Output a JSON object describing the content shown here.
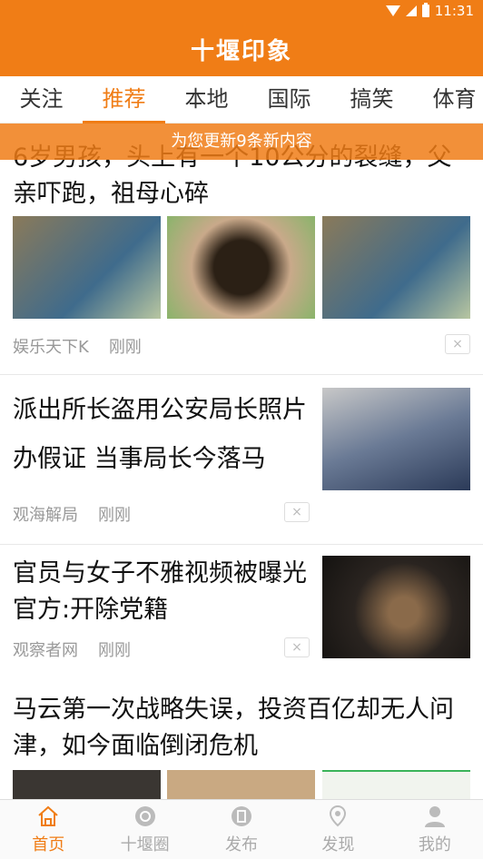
{
  "status": {
    "time": "11:31"
  },
  "app": {
    "title": "十堰印象"
  },
  "tabs": [
    {
      "label": "关注"
    },
    {
      "label": "推荐"
    },
    {
      "label": "本地"
    },
    {
      "label": "国际"
    },
    {
      "label": "搞笑"
    },
    {
      "label": "体育"
    }
  ],
  "notice": "为您更新9条新内容",
  "feed": [
    {
      "title": "6岁男孩，头上有一个10公分的裂缝，父亲吓跑，祖母心碎",
      "source": "娱乐天下K",
      "time": "刚刚",
      "close": "×"
    },
    {
      "title": "派出所长盗用公安局长照片办假证 当事局长今落马",
      "source": "观海解局",
      "time": "刚刚",
      "close": "×"
    },
    {
      "title": "官员与女子不雅视频被曝光 官方:开除党籍",
      "source": "观察者网",
      "time": "刚刚",
      "close": "×"
    },
    {
      "title": "马云第一次战略失误，投资百亿却无人问津，如今面临倒闭危机"
    }
  ],
  "bottom_nav": [
    {
      "label": "首页"
    },
    {
      "label": "十堰圈"
    },
    {
      "label": "发布"
    },
    {
      "label": "发现"
    },
    {
      "label": "我的"
    }
  ],
  "colors": {
    "accent": "#f07d16"
  }
}
